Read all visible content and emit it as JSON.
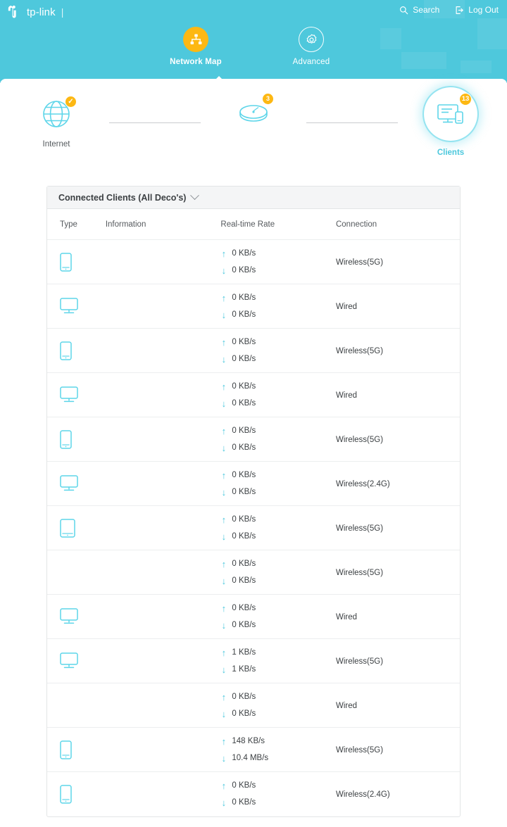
{
  "header": {
    "brand_name": "tp-link",
    "brand_separator": "|",
    "actions": [
      {
        "label": "Search",
        "icon": "search-icon"
      },
      {
        "label": "Log Out",
        "icon": "logout-icon"
      }
    ],
    "nav": [
      {
        "label": "Network Map",
        "icon": "network-map-icon",
        "active": true
      },
      {
        "label": "Advanced",
        "icon": "gear-icon",
        "active": false
      }
    ],
    "accent_color": "#4ec8dc",
    "highlight_color": "#fdb813"
  },
  "topology": {
    "internet": {
      "label": "Internet",
      "icon": "globe-icon",
      "badge": "✓"
    },
    "deco": {
      "label": "",
      "icon": "deco-icon",
      "badge": "3"
    },
    "clients": {
      "label": "Clients",
      "icon": "devices-icon",
      "badge": "13"
    }
  },
  "clients_panel": {
    "title": "Connected Clients (All Deco's)",
    "collapse_icon": "chevron-down-icon",
    "columns": [
      "Type",
      "Information",
      "Real-time Rate",
      "Connection"
    ],
    "up_arrow": "↑",
    "down_arrow": "↓",
    "rows": [
      {
        "type_icon": "phone-icon",
        "information": "",
        "up": "0 KB/s",
        "down": "0 KB/s",
        "connection": "Wireless(5G)"
      },
      {
        "type_icon": "desktop-icon",
        "information": "",
        "up": "0 KB/s",
        "down": "0 KB/s",
        "connection": "Wired"
      },
      {
        "type_icon": "phone-icon",
        "information": "",
        "up": "0 KB/s",
        "down": "0 KB/s",
        "connection": "Wireless(5G)"
      },
      {
        "type_icon": "desktop-icon",
        "information": "",
        "up": "0 KB/s",
        "down": "0 KB/s",
        "connection": "Wired"
      },
      {
        "type_icon": "phone-icon",
        "information": "",
        "up": "0 KB/s",
        "down": "0 KB/s",
        "connection": "Wireless(5G)"
      },
      {
        "type_icon": "desktop-icon",
        "information": "",
        "up": "0 KB/s",
        "down": "0 KB/s",
        "connection": "Wireless(2.4G)"
      },
      {
        "type_icon": "tablet-icon",
        "information": "",
        "up": "0 KB/s",
        "down": "0 KB/s",
        "connection": "Wireless(5G)"
      },
      {
        "type_icon": "none",
        "information": "",
        "up": "0 KB/s",
        "down": "0 KB/s",
        "connection": "Wireless(5G)"
      },
      {
        "type_icon": "desktop-icon",
        "information": "",
        "up": "0 KB/s",
        "down": "0 KB/s",
        "connection": "Wired"
      },
      {
        "type_icon": "desktop-icon",
        "information": "",
        "up": "1 KB/s",
        "down": "1 KB/s",
        "connection": "Wireless(5G)"
      },
      {
        "type_icon": "none",
        "information": "",
        "up": "0 KB/s",
        "down": "0 KB/s",
        "connection": "Wired"
      },
      {
        "type_icon": "phone-icon",
        "information": "",
        "up": "148 KB/s",
        "down": "10.4 MB/s",
        "connection": "Wireless(5G)"
      },
      {
        "type_icon": "phone-icon",
        "information": "",
        "up": "0 KB/s",
        "down": "0 KB/s",
        "connection": "Wireless(2.4G)"
      }
    ]
  }
}
